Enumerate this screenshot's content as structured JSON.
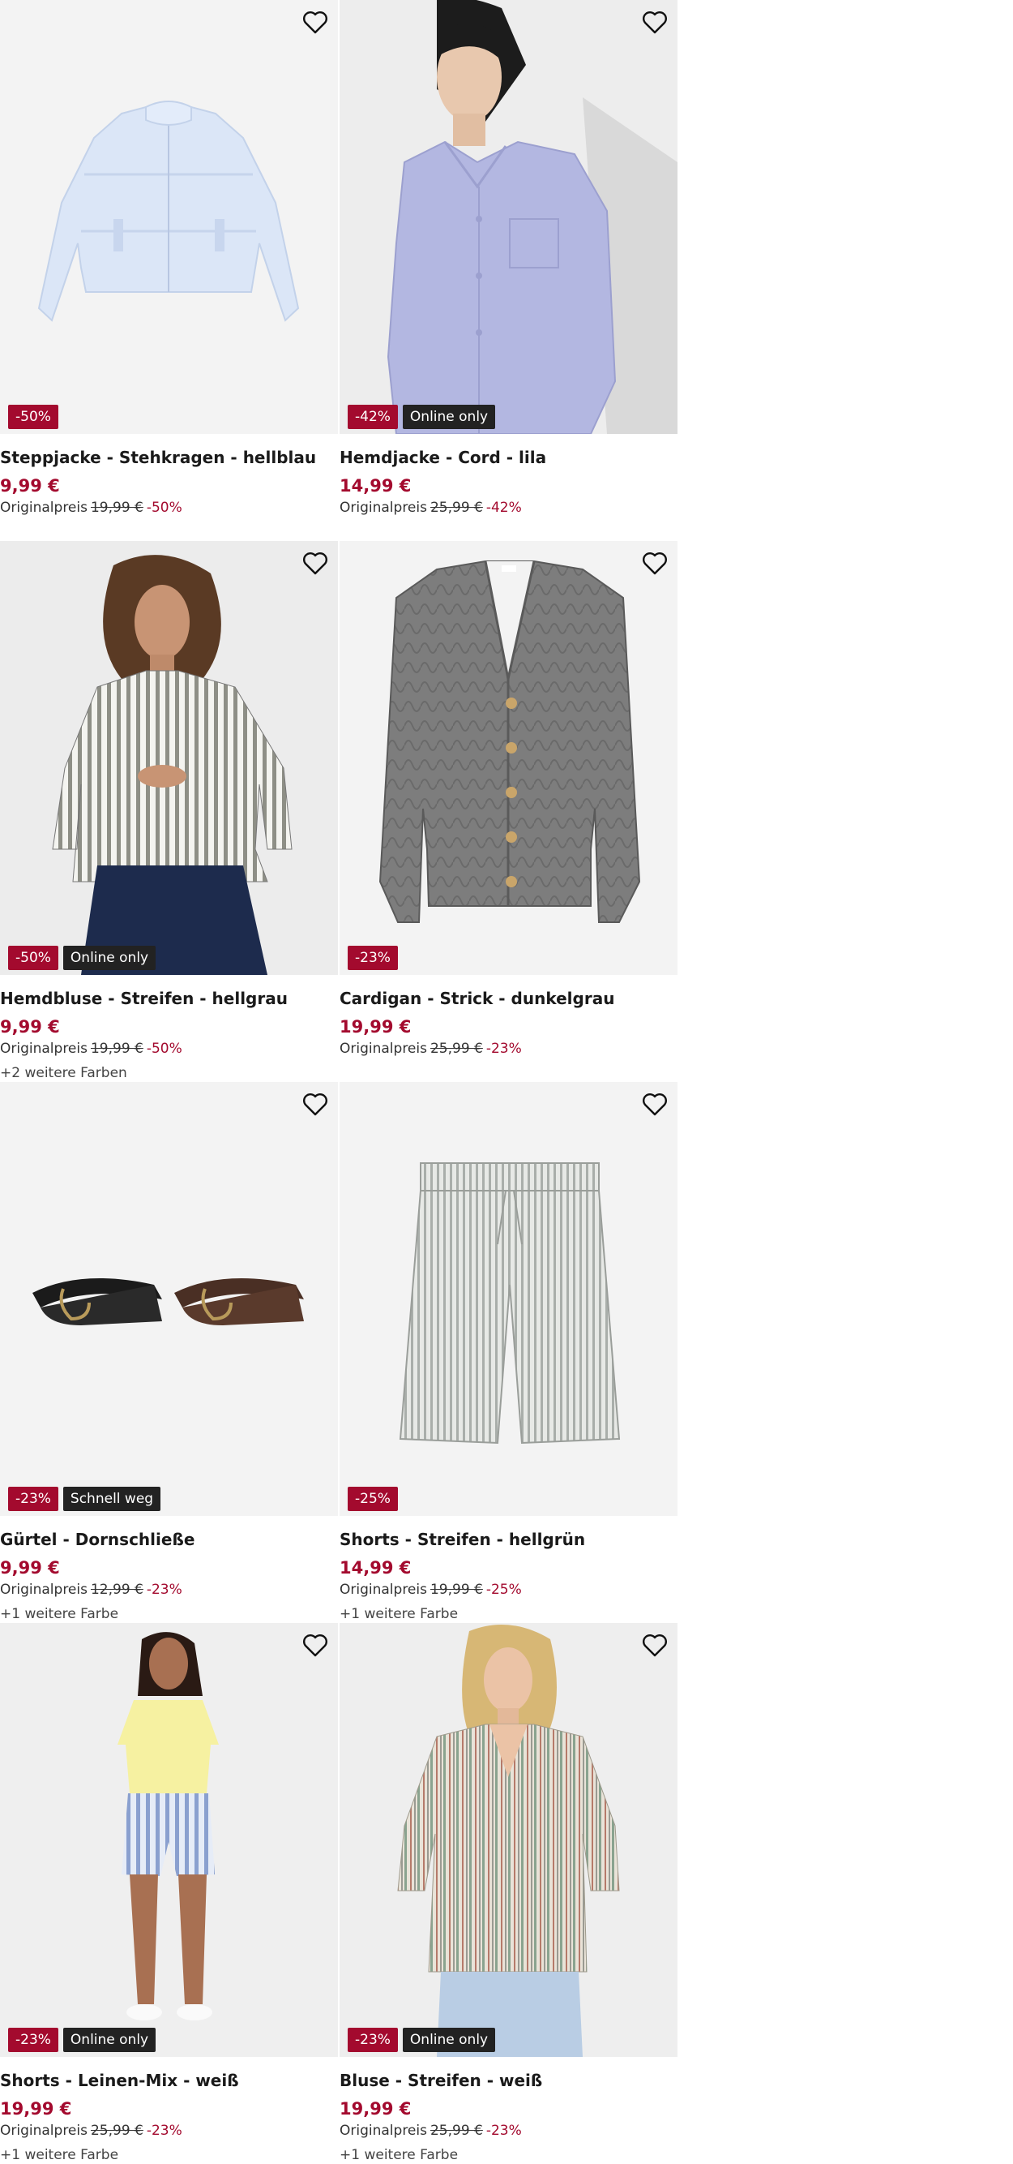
{
  "colors": {
    "sale_badge": "#a30a2e",
    "tag_badge": "#222222",
    "price": "#a30a2e",
    "image_bg": "#f2f2f2"
  },
  "labels": {
    "original_price": "Originalpreis"
  },
  "products": [
    {
      "title": "Steppjacke - Stehkragen - hellblau",
      "price": "9,99 €",
      "original_price": "19,99 €",
      "discount": "-50%",
      "badge_discount": "-50%",
      "badge_tag": "",
      "more_colors": "",
      "image_icon": "puffer-jacket-image"
    },
    {
      "title": "Hemdjacke - Cord - lila",
      "price": "14,99 €",
      "original_price": "25,99 €",
      "discount": "-42%",
      "badge_discount": "-42%",
      "badge_tag": "Online only",
      "more_colors": "",
      "image_icon": "model-shirt-jacket-image"
    },
    {
      "title": "Hemdbluse - Streifen - hellgrau",
      "price": "9,99 €",
      "original_price": "19,99 €",
      "discount": "-50%",
      "badge_discount": "-50%",
      "badge_tag": "Online only",
      "more_colors": "+2 weitere Farben",
      "image_icon": "model-striped-blouse-image"
    },
    {
      "title": "Cardigan - Strick - dunkelgrau",
      "price": "19,99 €",
      "original_price": "25,99 €",
      "discount": "-23%",
      "badge_discount": "-23%",
      "badge_tag": "",
      "more_colors": "",
      "image_icon": "cardigan-image"
    },
    {
      "title": "Gürtel - Dornschließe",
      "price": "9,99 €",
      "original_price": "12,99 €",
      "discount": "-23%",
      "badge_discount": "-23%",
      "badge_tag": "Schnell weg",
      "more_colors": "+1 weitere Farbe",
      "image_icon": "belts-image"
    },
    {
      "title": "Shorts - Streifen - hellgrün",
      "price": "14,99 €",
      "original_price": "19,99 €",
      "discount": "-25%",
      "badge_discount": "-25%",
      "badge_tag": "",
      "more_colors": "+1 weitere Farbe",
      "image_icon": "striped-shorts-image"
    },
    {
      "title": "Shorts - Leinen-Mix - weiß",
      "price": "19,99 €",
      "original_price": "25,99 €",
      "discount": "-23%",
      "badge_discount": "-23%",
      "badge_tag": "Online only",
      "more_colors": "+1 weitere Farbe",
      "image_icon": "model-linen-shorts-image"
    },
    {
      "title": "Bluse - Streifen - weiß",
      "price": "19,99 €",
      "original_price": "25,99 €",
      "discount": "-23%",
      "badge_discount": "-23%",
      "badge_tag": "Online only",
      "more_colors": "+1 weitere Farbe",
      "image_icon": "model-striped-blouse-white-image"
    }
  ]
}
